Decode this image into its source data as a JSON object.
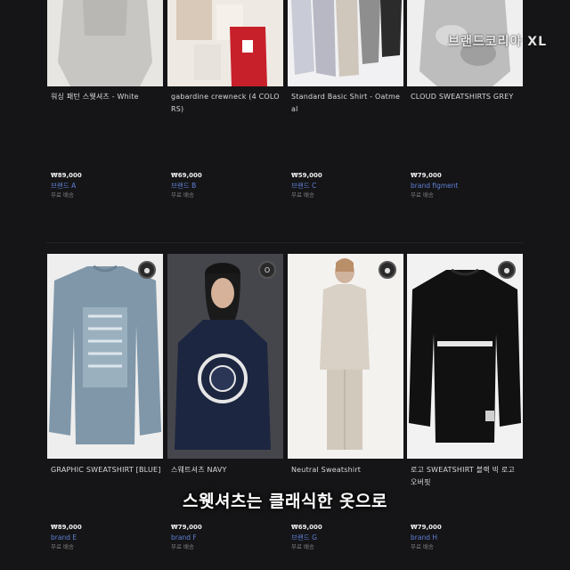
{
  "watermark": "브랜드코리아 XL",
  "subtitle": "스웻셔츠는 클래식한 옷으로",
  "row1": [
    {
      "name": "워싱 패턴 스웻셔츠 - White",
      "price": "₩89,000",
      "brand": "브랜드 A",
      "meta": "무료 배송"
    },
    {
      "name": "gabardine crewneck (4 COLORS)",
      "price": "₩69,000",
      "brand": "브랜드 B",
      "meta": "무료 배송"
    },
    {
      "name": "Standard Basic Shirt - Oatmeal",
      "price": "₩59,000",
      "brand": "브랜드 C",
      "meta": "무료 배송"
    },
    {
      "name": "CLOUD SWEATSHIRTS GREY",
      "price": "₩79,000",
      "brand": "brand figment",
      "meta": "무료 배송"
    }
  ],
  "row2": [
    {
      "name": "GRAPHIC SWEATSHIRT [BLUE]",
      "price": "₩89,000",
      "brand": "brand E",
      "meta": "무료 배송",
      "badge": ""
    },
    {
      "name": "스웨트셔츠 NAVY",
      "price": "₩79,000",
      "brand": "brand F",
      "meta": "무료 배송",
      "badge": "O"
    },
    {
      "name": "Neutral Sweatshirt",
      "price": "₩69,000",
      "brand": "브랜드 G",
      "meta": "무료 배송",
      "badge": ""
    },
    {
      "name": "로고 SWEATSHIRT 블랙 빅 로고 오버핏",
      "price": "₩79,000",
      "brand": "brand H",
      "meta": "무료 배송",
      "badge": ""
    }
  ]
}
